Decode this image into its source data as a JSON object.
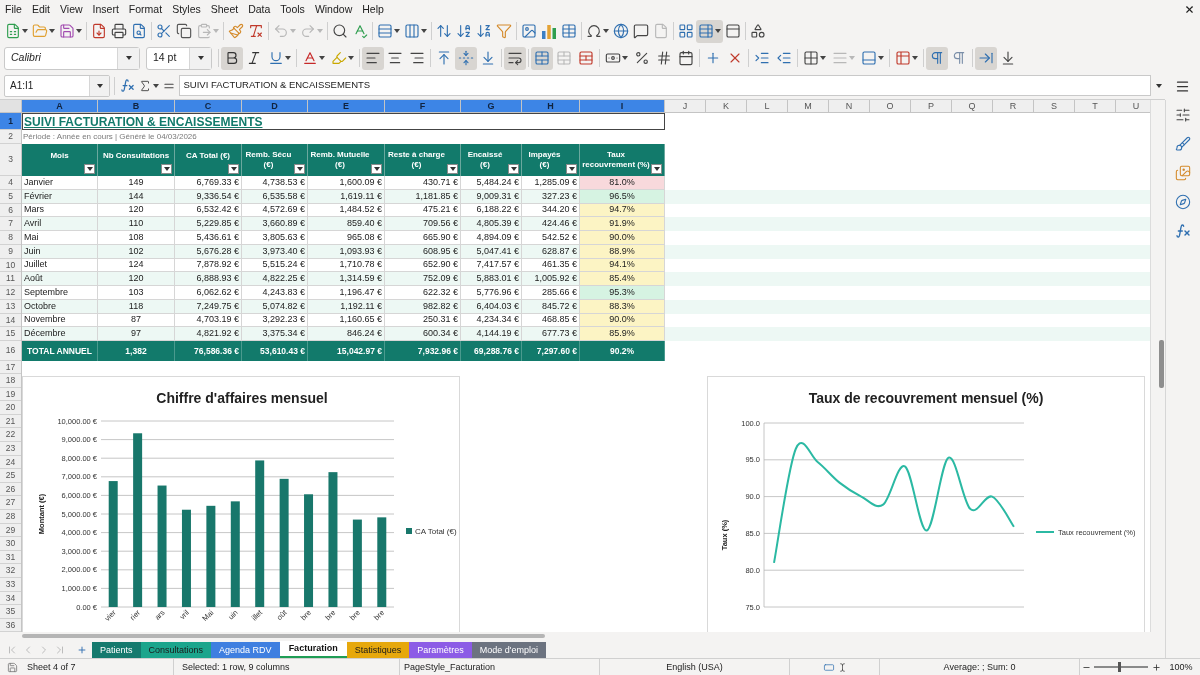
{
  "menu_bar": {
    "items": [
      "File",
      "Edit",
      "View",
      "Insert",
      "Format",
      "Styles",
      "Sheet",
      "Data",
      "Tools",
      "Window",
      "Help"
    ]
  },
  "standard_toolbar": {
    "groups": [
      [
        {
          "kind": "new",
          "pressed": false,
          "disabled": false
        },
        {
          "kind": "open",
          "pressed": false,
          "disabled": false
        },
        {
          "kind": "save",
          "pressed": false,
          "disabled": false
        }
      ],
      [
        {
          "kind": "export_pdf",
          "pressed": false,
          "disabled": false
        },
        {
          "kind": "print",
          "pressed": false,
          "disabled": false
        },
        {
          "kind": "print_preview",
          "pressed": false,
          "disabled": false
        }
      ],
      [
        {
          "kind": "cut",
          "pressed": false,
          "disabled": false
        },
        {
          "kind": "copy",
          "pressed": false,
          "disabled": false
        },
        {
          "kind": "paste",
          "pressed": false,
          "disabled": true
        }
      ],
      [
        {
          "kind": "clone_formatting",
          "pressed": false,
          "disabled": false
        },
        {
          "kind": "clear_formatting",
          "pressed": false,
          "disabled": false
        }
      ],
      [
        {
          "kind": "undo",
          "pressed": false,
          "disabled": true
        },
        {
          "kind": "redo",
          "pressed": false,
          "disabled": true
        }
      ],
      [
        {
          "kind": "find_replace",
          "pressed": false,
          "disabled": false
        },
        {
          "kind": "spelling",
          "pressed": false,
          "disabled": false
        }
      ],
      [
        {
          "kind": "rows",
          "pressed": false,
          "disabled": false
        },
        {
          "kind": "columns",
          "pressed": false,
          "disabled": false
        }
      ],
      [
        {
          "kind": "sort",
          "pressed": false,
          "disabled": false
        },
        {
          "kind": "sort_ascending",
          "pressed": false,
          "disabled": false
        },
        {
          "kind": "sort_descending",
          "pressed": false,
          "disabled": false
        },
        {
          "kind": "autofilter",
          "pressed": false,
          "disabled": false
        }
      ],
      [
        {
          "kind": "image",
          "pressed": false,
          "disabled": false
        },
        {
          "kind": "chart",
          "pressed": false,
          "disabled": false
        },
        {
          "kind": "pivot_table",
          "pressed": false,
          "disabled": false
        }
      ],
      [
        {
          "kind": "special_character",
          "pressed": false,
          "disabled": false
        },
        {
          "kind": "hyperlink",
          "pressed": false,
          "disabled": false
        },
        {
          "kind": "comment",
          "pressed": false,
          "disabled": false
        },
        {
          "kind": "headers_footers",
          "pressed": false,
          "disabled": true
        }
      ],
      [
        {
          "kind": "print_area",
          "pressed": false,
          "disabled": false
        },
        {
          "kind": "freeze",
          "pressed": true,
          "disabled": false
        },
        {
          "kind": "split_window",
          "pressed": false,
          "disabled": false
        }
      ],
      [
        {
          "kind": "draw_functions",
          "pressed": false,
          "disabled": false
        }
      ]
    ]
  },
  "formatting_toolbar": {
    "font_name": "Calibri",
    "font_size": "14 pt",
    "groups": [
      [
        {
          "kind": "bold",
          "pressed": true,
          "disabled": false
        },
        {
          "kind": "italic",
          "pressed": false,
          "disabled": false
        },
        {
          "kind": "underline",
          "pressed": false,
          "disabled": false
        }
      ],
      [
        {
          "kind": "font_color",
          "pressed": false,
          "disabled": false
        },
        {
          "kind": "highlight",
          "pressed": false,
          "disabled": false
        }
      ],
      [
        {
          "kind": "align_left",
          "pressed": true,
          "disabled": false
        },
        {
          "kind": "align_center",
          "pressed": false,
          "disabled": false
        },
        {
          "kind": "align_right",
          "pressed": false,
          "disabled": false
        }
      ],
      [
        {
          "kind": "align_top",
          "pressed": false,
          "disabled": false
        },
        {
          "kind": "align_middle",
          "pressed": true,
          "disabled": false
        },
        {
          "kind": "align_bottom",
          "pressed": false,
          "disabled": false
        }
      ],
      [
        {
          "kind": "wrap_text",
          "pressed": true,
          "disabled": false
        }
      ],
      [
        {
          "kind": "merge_center",
          "pressed": true,
          "disabled": false
        },
        {
          "kind": "merge",
          "pressed": false,
          "disabled": true
        },
        {
          "kind": "unmerge",
          "pressed": false,
          "disabled": false
        }
      ],
      [
        {
          "kind": "currency",
          "pressed": false,
          "disabled": false
        },
        {
          "kind": "percent",
          "pressed": false,
          "disabled": false
        },
        {
          "kind": "number",
          "pressed": false,
          "disabled": false
        },
        {
          "kind": "date",
          "pressed": false,
          "disabled": false
        }
      ],
      [
        {
          "kind": "add_decimal",
          "pressed": false,
          "disabled": false
        },
        {
          "kind": "delete_decimal",
          "pressed": false,
          "disabled": false
        }
      ],
      [
        {
          "kind": "indent_increase",
          "pressed": false,
          "disabled": false
        },
        {
          "kind": "indent_decrease",
          "pressed": false,
          "disabled": false
        }
      ],
      [
        {
          "kind": "borders",
          "pressed": false,
          "disabled": false
        },
        {
          "kind": "border_style",
          "pressed": false,
          "disabled": true
        },
        {
          "kind": "border_color",
          "pressed": false,
          "disabled": false
        }
      ],
      [
        {
          "kind": "conditional",
          "pressed": false,
          "disabled": false
        }
      ],
      [
        {
          "kind": "ltr",
          "pressed": true,
          "disabled": false
        },
        {
          "kind": "rtl",
          "pressed": false,
          "disabled": false
        }
      ],
      [
        {
          "kind": "text_ltr",
          "pressed": true,
          "disabled": false
        },
        {
          "kind": "text_ttb",
          "pressed": false,
          "disabled": false
        }
      ]
    ]
  },
  "formula_bar": {
    "name_box": "A1:I1",
    "content": "SUIVI FACTURATION & ENCAISSEMENTS"
  },
  "sheet": {
    "column_headers": [
      {
        "label": "A",
        "selected": true
      },
      {
        "label": "B",
        "selected": true
      },
      {
        "label": "C",
        "selected": true
      },
      {
        "label": "D",
        "selected": true
      },
      {
        "label": "E",
        "selected": true
      },
      {
        "label": "F",
        "selected": true
      },
      {
        "label": "G",
        "selected": true
      },
      {
        "label": "H",
        "selected": true
      },
      {
        "label": "I",
        "selected": true
      },
      {
        "label": "J",
        "selected": false
      },
      {
        "label": "K",
        "selected": false
      },
      {
        "label": "L",
        "selected": false
      },
      {
        "label": "M",
        "selected": false
      },
      {
        "label": "N",
        "selected": false
      },
      {
        "label": "O",
        "selected": false
      },
      {
        "label": "P",
        "selected": false
      },
      {
        "label": "Q",
        "selected": false
      },
      {
        "label": "R",
        "selected": false
      },
      {
        "label": "S",
        "selected": false
      },
      {
        "label": "T",
        "selected": false
      },
      {
        "label": "U",
        "selected": false
      }
    ],
    "row_headers": [
      {
        "label": "1",
        "selected": true
      },
      {
        "label": "2",
        "selected": false
      },
      {
        "label": "3",
        "selected": false
      },
      {
        "label": "4",
        "selected": false
      },
      {
        "label": "5",
        "selected": false
      },
      {
        "label": "6",
        "selected": false
      },
      {
        "label": "7",
        "selected": false
      },
      {
        "label": "8",
        "selected": false
      },
      {
        "label": "9",
        "selected": false
      },
      {
        "label": "10",
        "selected": false
      },
      {
        "label": "11",
        "selected": false
      },
      {
        "label": "12",
        "selected": false
      },
      {
        "label": "13",
        "selected": false
      },
      {
        "label": "14",
        "selected": false
      },
      {
        "label": "15",
        "selected": false
      },
      {
        "label": "16",
        "selected": false
      },
      {
        "label": "17",
        "selected": false
      },
      {
        "label": "18",
        "selected": false
      },
      {
        "label": "19",
        "selected": false
      },
      {
        "label": "20",
        "selected": false
      },
      {
        "label": "21",
        "selected": false
      },
      {
        "label": "22",
        "selected": false
      },
      {
        "label": "23",
        "selected": false
      },
      {
        "label": "24",
        "selected": false
      },
      {
        "label": "25",
        "selected": false
      },
      {
        "label": "26",
        "selected": false
      },
      {
        "label": "27",
        "selected": false
      },
      {
        "label": "28",
        "selected": false
      },
      {
        "label": "29",
        "selected": false
      },
      {
        "label": "30",
        "selected": false
      },
      {
        "label": "31",
        "selected": false
      },
      {
        "label": "32",
        "selected": false
      },
      {
        "label": "33",
        "selected": false
      },
      {
        "label": "34",
        "selected": false
      },
      {
        "label": "35",
        "selected": false
      },
      {
        "label": "36",
        "selected": false
      }
    ],
    "title": "SUIVI FACTURATION & ENCAISSEMENTS",
    "subtitle": "Période : Année en cours | Généré le 04/03/2026",
    "table": {
      "columns": [
        "Mois",
        "Nb Consultations",
        "CA Total (€)",
        "Remb. Sécu (€)",
        "Remb. Mutuelle (€)",
        "Reste à charge (€)",
        "Encaissé (€)",
        "Impayés (€)",
        "Taux recouvrement (%)"
      ],
      "rows": [
        {
          "cells": [
            "Janvier",
            "149",
            "6,769.33 €",
            "4,738.53 €",
            "1,600.09 €",
            "430.71 €",
            "5,484.24 €",
            "1,285.09 €",
            "81.0%"
          ],
          "color": "#f8d9dc"
        },
        {
          "cells": [
            "Février",
            "144",
            "9,336.54 €",
            "6,535.58 €",
            "1,619.11 €",
            "1,181.85 €",
            "9,009.31 €",
            "327.23 €",
            "96.5%"
          ],
          "color": "#d6f3e2"
        },
        {
          "cells": [
            "Mars",
            "120",
            "6,532.42 €",
            "4,572.69 €",
            "1,484.52 €",
            "475.21 €",
            "6,188.22 €",
            "344.20 €",
            "94.7%"
          ],
          "color": "#fcf4c4"
        },
        {
          "cells": [
            "Avril",
            "110",
            "5,229.85 €",
            "3,660.89 €",
            "859.40 €",
            "709.56 €",
            "4,805.39 €",
            "424.46 €",
            "91.9%"
          ],
          "color": "#fcf4c4"
        },
        {
          "cells": [
            "Mai",
            "108",
            "5,436.61 €",
            "3,805.63 €",
            "965.08 €",
            "665.90 €",
            "4,894.09 €",
            "542.52 €",
            "90.0%"
          ],
          "color": "#fcf4c4"
        },
        {
          "cells": [
            "Juin",
            "102",
            "5,676.28 €",
            "3,973.40 €",
            "1,093.93 €",
            "608.95 €",
            "5,047.41 €",
            "628.87 €",
            "88.9%"
          ],
          "color": "#fcf4c4"
        },
        {
          "cells": [
            "Juillet",
            "124",
            "7,878.92 €",
            "5,515.24 €",
            "1,710.78 €",
            "652.90 €",
            "7,417.57 €",
            "461.35 €",
            "94.1%"
          ],
          "color": "#fcf4c4"
        },
        {
          "cells": [
            "Août",
            "120",
            "6,888.93 €",
            "4,822.25 €",
            "1,314.59 €",
            "752.09 €",
            "5,883.01 €",
            "1,005.92 €",
            "85.4%"
          ],
          "color": "#fcf4c4"
        },
        {
          "cells": [
            "Septembre",
            "103",
            "6,062.62 €",
            "4,243.83 €",
            "1,196.47 €",
            "622.32 €",
            "5,776.96 €",
            "285.66 €",
            "95.3%"
          ],
          "color": "#d6f3e2"
        },
        {
          "cells": [
            "Octobre",
            "118",
            "7,249.75 €",
            "5,074.82 €",
            "1,192.11 €",
            "982.82 €",
            "6,404.03 €",
            "845.72 €",
            "88.3%"
          ],
          "color": "#fcf4c4"
        },
        {
          "cells": [
            "Novembre",
            "87",
            "4,703.19 €",
            "3,292.23 €",
            "1,160.65 €",
            "250.31 €",
            "4,234.34 €",
            "468.85 €",
            "90.0%"
          ],
          "color": "#fcf4c4"
        },
        {
          "cells": [
            "Décembre",
            "97",
            "4,821.92 €",
            "3,375.34 €",
            "846.24 €",
            "600.34 €",
            "4,144.19 €",
            "677.73 €",
            "85.9%"
          ],
          "color": "#fcf4c4"
        }
      ],
      "total": [
        "TOTAL ANNUEL",
        "1,382",
        "76,586.36 €",
        "53,610.43 €",
        "15,042.97 €",
        "7,932.96 €",
        "69,288.76 €",
        "7,297.60 €",
        "90.2%"
      ]
    }
  },
  "charts": [
    {
      "chart_data": {
        "type": "bar",
        "title": "Chiffre d'affaires mensuel",
        "ylabel": "Montant (€)",
        "categories": [
          "vier",
          "rier",
          "ars",
          "vril",
          "Mai",
          "uin",
          "illet",
          "oût",
          "bre",
          "bre",
          "bre",
          "bre"
        ],
        "series": [
          {
            "name": "CA Total (€)",
            "color": "#18776b",
            "values": [
              6770,
              9340,
              6530,
              5230,
              5440,
              5680,
              7880,
              6890,
              6060,
              7250,
              4700,
              4820
            ]
          }
        ],
        "ylim": [
          0,
          10000
        ],
        "yticks": [
          {
            "value": 0,
            "label": "0.00 €"
          },
          {
            "value": 1000,
            "label": "1,000.00 €"
          },
          {
            "value": 2000,
            "label": "2,000.00 €"
          },
          {
            "value": 3000,
            "label": "3,000.00 €"
          },
          {
            "value": 4000,
            "label": "4,000.00 €"
          },
          {
            "value": 5000,
            "label": "5,000.00 €"
          },
          {
            "value": 6000,
            "label": "6,000.00 €"
          },
          {
            "value": 7000,
            "label": "7,000.00 €"
          },
          {
            "value": 8000,
            "label": "8,000.00 €"
          },
          {
            "value": 9000,
            "label": "9,000.00 €"
          },
          {
            "value": 10000,
            "label": "10,000.00 €"
          }
        ],
        "grid": true
      }
    },
    {
      "chart_data": {
        "type": "line",
        "title": "Taux de recouvrement mensuel (%)",
        "ylabel": "Taux (%)",
        "series": [
          {
            "name": "Taux recouvrement (%)",
            "color": "#2bb9a3",
            "values": [
              81.0,
              96.5,
              94.7,
              91.9,
              90.0,
              88.9,
              94.1,
              85.4,
              95.3,
              88.3,
              90.0,
              85.9
            ]
          }
        ],
        "ylim": [
          75,
          100
        ],
        "yticks": [
          {
            "value": 75,
            "label": "75.0"
          },
          {
            "value": 80,
            "label": "80.0"
          },
          {
            "value": 85,
            "label": "85.0"
          },
          {
            "value": 90,
            "label": "90.0"
          },
          {
            "value": 95,
            "label": "95.0"
          },
          {
            "value": 100,
            "label": "100.0"
          }
        ],
        "grid": true
      }
    }
  ],
  "sheet_tabs": {
    "items": [
      {
        "label": "Patients",
        "color": "#157a6e",
        "selected": false
      },
      {
        "label": "Consultations",
        "color": "#1ba58c",
        "selected": false
      },
      {
        "label": "Agenda RDV",
        "color": "#3f7fe0",
        "selected": false
      },
      {
        "label": "Facturation",
        "color": "#1f9d55",
        "selected": true
      },
      {
        "label": "Statistiques",
        "color": "#e6a80c",
        "selected": false
      },
      {
        "label": "Paramètres",
        "color": "#8c5ce6",
        "selected": false
      },
      {
        "label": "Mode d'emploi",
        "color": "#6c7380",
        "selected": false
      }
    ]
  },
  "status_bar": {
    "sheet": "Sheet 4 of 7",
    "selection": "Selected: 1 row, 9 columns",
    "page_style": "PageStyle_Facturation",
    "language": "English (USA)",
    "summary": "Average: ; Sum: 0",
    "zoom": {
      "level": 0.44,
      "reading": "100%"
    }
  }
}
